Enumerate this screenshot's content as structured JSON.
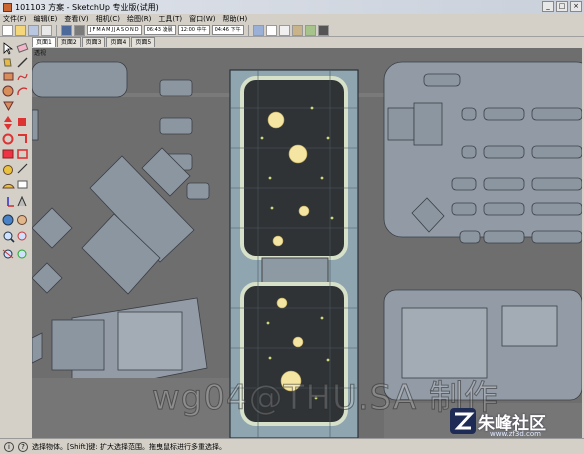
{
  "window": {
    "title": "101103 方案 - SketchUp 专业版(试用)"
  },
  "menu": [
    "文件(F)",
    "编辑(E)",
    "查看(V)",
    "相机(C)",
    "绘图(R)",
    "工具(T)",
    "窗口(W)",
    "帮助(H)"
  ],
  "toolbar": {
    "months": [
      "J",
      "F",
      "M",
      "A",
      "M",
      "J",
      "J",
      "A",
      "S",
      "O",
      "N",
      "D"
    ],
    "time_left": "06:43 凌晨",
    "time_mid": "12:00 中午",
    "time_right": "04:46 下午"
  },
  "tabs": [
    "页面1",
    "页面2",
    "页面3",
    "页面4",
    "页面5"
  ],
  "viewport": {
    "label": "透视"
  },
  "status": {
    "text": "选择物体。[Shift]键: 扩大选择范围。拖曳鼠标进行多重选择。",
    "icon": "info-icon"
  },
  "watermark": "wg04@THU.SA 制作",
  "logo": {
    "text": "朱峰社区",
    "sub": "www.zf3d.com"
  },
  "colors": {
    "ground": "#6d6d6d",
    "block": "#8e9aa6",
    "glass": "#90a8b4",
    "plaza": "#2f3336",
    "light": "#f5e7a3"
  }
}
